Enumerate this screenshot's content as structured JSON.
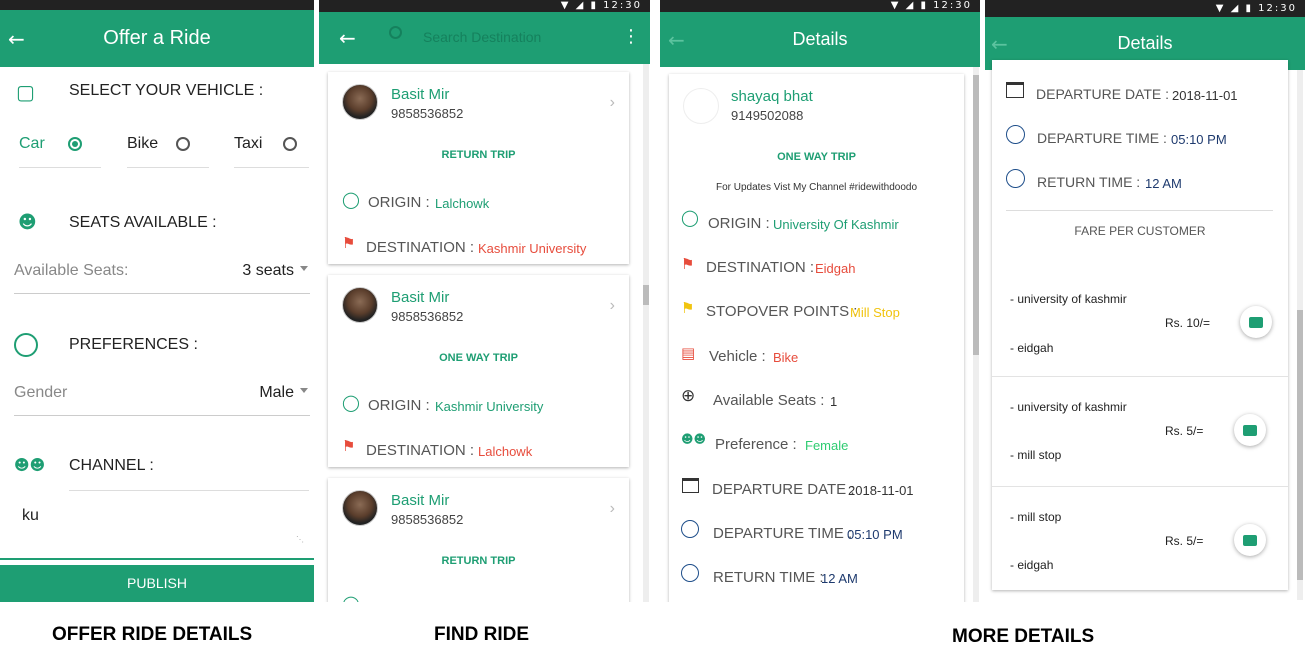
{
  "panel1": {
    "title": "Offer a Ride",
    "vehicle_heading": "SELECT YOUR VEHICLE :",
    "vehicle_options": [
      "Car",
      "Bike",
      "Taxi"
    ],
    "seats_heading": "SEATS AVAILABLE :",
    "seats_label": "Available Seats:",
    "seats_value": "3 seats",
    "pref_heading": "PREFERENCES :",
    "gender_label": "Gender",
    "gender_value": "Male",
    "channel_heading": "CHANNEL :",
    "channel_value": "ku",
    "publish_label": "PUBLISH"
  },
  "panel2": {
    "search_placeholder": "Search Destination",
    "status_time": "12:30",
    "origin_label": "ORIGIN :",
    "dest_label": "DESTINATION :",
    "cards": [
      {
        "name": "Basit Mir",
        "phone": "9858536852",
        "trip": "RETURN TRIP",
        "origin": "Lalchowk",
        "dest": "Kashmir University"
      },
      {
        "name": "Basit Mir",
        "phone": "9858536852",
        "trip": "ONE WAY TRIP",
        "origin": "Kashmir University",
        "dest": "Lalchowk"
      },
      {
        "name": "Basit Mir",
        "phone": "9858536852",
        "trip": "RETURN TRIP"
      }
    ]
  },
  "panel3": {
    "title": "Details",
    "status_time": "12:30",
    "name": "shayaq bhat",
    "phone": "9149502088",
    "trip": "ONE WAY TRIP",
    "updates": "For Updates Vist My Channel #ridewithdoodo",
    "rows": [
      {
        "label": "ORIGIN :",
        "value": "University Of Kashmir"
      },
      {
        "label": "DESTINATION :",
        "value": "Eidgah"
      },
      {
        "label": "STOPOVER POINTS :",
        "value": "Mill Stop"
      },
      {
        "label": "Vehicle :",
        "value": "Bike"
      },
      {
        "label": "Available Seats :",
        "value": "1"
      },
      {
        "label": "Preference :",
        "value": "Female"
      },
      {
        "label": "DEPARTURE DATE :",
        "value": "2018-11-01"
      },
      {
        "label": "DEPARTURE TIME :",
        "value": "05:10 PM"
      },
      {
        "label": "RETURN TIME :",
        "value": "12 AM"
      }
    ]
  },
  "panel4": {
    "title": "Details",
    "status_time": "12:30",
    "dep_date_label": "DEPARTURE DATE :",
    "dep_date_value": "2018-11-01",
    "dep_time_label": "DEPARTURE TIME :",
    "dep_time_value": "05:10 PM",
    "ret_time_label": "RETURN TIME :",
    "ret_time_value": "12 AM",
    "fare_heading": "FARE PER CUSTOMER",
    "fares": [
      {
        "from": "- university of kashmir",
        "to": "- eidgah",
        "price": "Rs. 10/="
      },
      {
        "from": "- university of kashmir",
        "to": "- mill stop",
        "price": "Rs. 5/="
      },
      {
        "from": "- mill stop",
        "to": "- eidgah",
        "price": "Rs. 5/="
      }
    ]
  },
  "captions": {
    "offer": "OFFER RIDE DETAILS",
    "find": "FIND RIDE",
    "more": "MORE DETAILS"
  },
  "colors": {
    "accent": "#1e9e73",
    "destination": "#e74c3c",
    "stopover": "#f1c40f"
  }
}
